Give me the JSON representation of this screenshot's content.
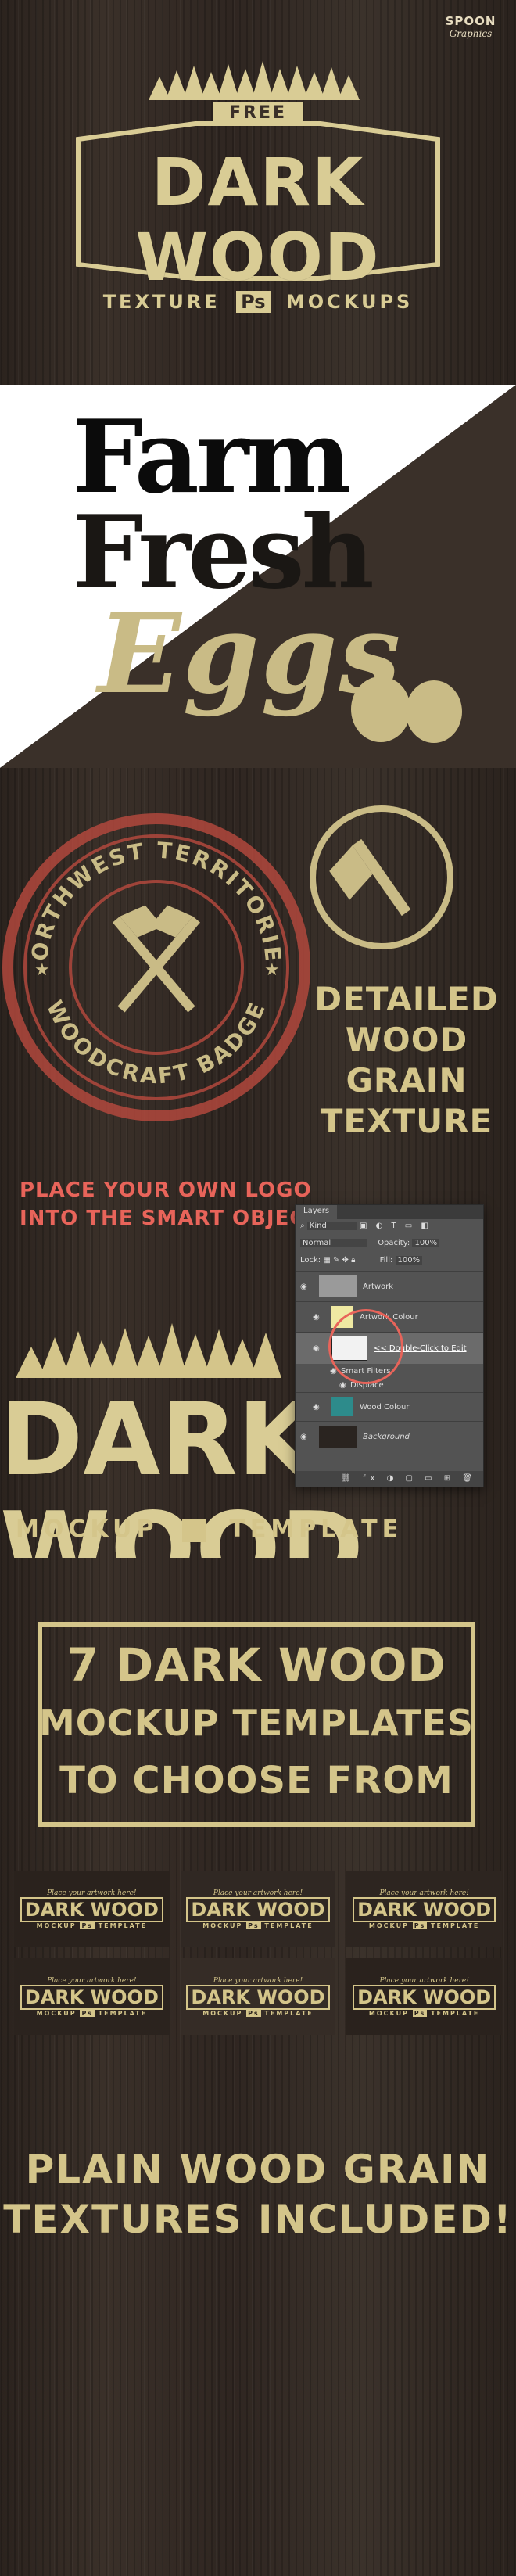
{
  "brand": {
    "line1": "SPOON",
    "line2": "Graphics"
  },
  "hero": {
    "free": "FREE",
    "title": "DARK WOOD",
    "subtitle_left": "TEXTURE",
    "ps": "Ps",
    "subtitle_right": "MOCKUPS"
  },
  "farm": {
    "line1": "Farm",
    "line2": "Fresh",
    "line3": "Eggs"
  },
  "badge": {
    "top_text": "NORTHWEST TERRITORIES",
    "bottom_text": "WOODCRAFT BADGE",
    "feature": [
      "DETAILED",
      "WOOD GRAIN",
      "TEXTURE"
    ]
  },
  "smart": {
    "heading": [
      "PLACE YOUR OWN LOGO",
      "INTO THE SMART OBJECT"
    ],
    "logo_title": "DARK WOOD",
    "logo_sub_left": "MOCKUP",
    "logo_sub_right": "TEMPLATE",
    "panel": {
      "tab": "Layers",
      "kind": "Kind",
      "blend": "Normal",
      "opacity_label": "Opacity:",
      "opacity_value": "100%",
      "lock_label": "Lock:",
      "fill_label": "Fill:",
      "fill_value": "100%",
      "layers": [
        {
          "name": "Artwork"
        },
        {
          "name": "Artwork Colour"
        },
        {
          "name": "<< Double-Click to Edit"
        },
        {
          "name": "Smart Filters"
        },
        {
          "name": "Displace"
        },
        {
          "name": "Wood Colour"
        },
        {
          "name": "Background"
        }
      ]
    }
  },
  "templates": {
    "heading": [
      "7 DARK WOOD",
      "MOCKUP TEMPLATES",
      "TO CHOOSE FROM"
    ],
    "thumbs": [
      {
        "script": "Place your artwork here!",
        "title": "DARK WOOD",
        "sub_left": "MOCKUP",
        "ps": "Ps",
        "sub_right": "TEMPLATE"
      },
      {
        "script": "Place your artwork here!",
        "title": "DARK WOOD",
        "sub_left": "MOCKUP",
        "ps": "Ps",
        "sub_right": "TEMPLATE"
      },
      {
        "script": "Place your artwork here!",
        "title": "DARK WOOD",
        "sub_left": "MOCKUP",
        "ps": "Ps",
        "sub_right": "TEMPLATE"
      },
      {
        "script": "Place your artwork here!",
        "title": "DARK WOOD",
        "sub_left": "MOCKUP",
        "ps": "Ps",
        "sub_right": "TEMPLATE"
      },
      {
        "script": "Place your artwork here!",
        "title": "DARK WOOD",
        "sub_left": "MOCKUP",
        "ps": "Ps",
        "sub_right": "TEMPLATE"
      },
      {
        "script": "Place your artwork here!",
        "title": "DARK WOOD",
        "sub_left": "MOCKUP",
        "ps": "Ps",
        "sub_right": "TEMPLATE"
      }
    ]
  },
  "plain": {
    "heading": [
      "PLAIN WOOD GRAIN",
      "TEXTURES INCLUDED!"
    ]
  },
  "colors": {
    "gold": "#d8c98f",
    "red_heading": "#e8645a",
    "white": "#ffffff",
    "black": "#0b0b0b"
  }
}
